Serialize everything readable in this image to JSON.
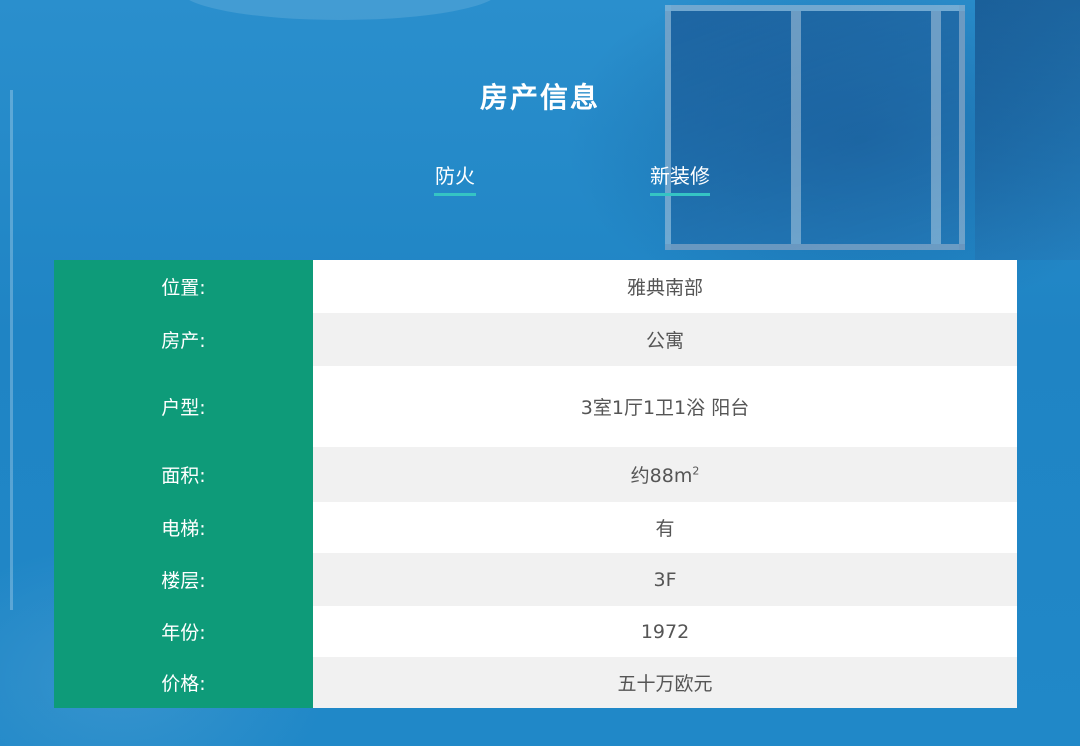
{
  "page": {
    "title": "房产信息"
  },
  "tabs": [
    {
      "label": "防火"
    },
    {
      "label": "新装修"
    }
  ],
  "property_table": {
    "rows": [
      {
        "label": "位置:",
        "value": "雅典南部"
      },
      {
        "label": "房产:",
        "value": "公寓"
      },
      {
        "label": "户型:",
        "value": "3室1厅1卫1浴 阳台"
      },
      {
        "label": "面积:",
        "value": "约88m",
        "value_sup": "2"
      },
      {
        "label": "电梯:",
        "value": "有"
      },
      {
        "label": "楼层:",
        "value": "3F"
      },
      {
        "label": "年份:",
        "value": "1972"
      },
      {
        "label": "价格:",
        "value": "五十万欧元"
      }
    ]
  },
  "colors": {
    "background": "#1f86c6",
    "label_column": "#0e9b79",
    "tab_underline": "#35c4c4",
    "row_alt": "#f1f1f1",
    "value_text": "#555555"
  }
}
